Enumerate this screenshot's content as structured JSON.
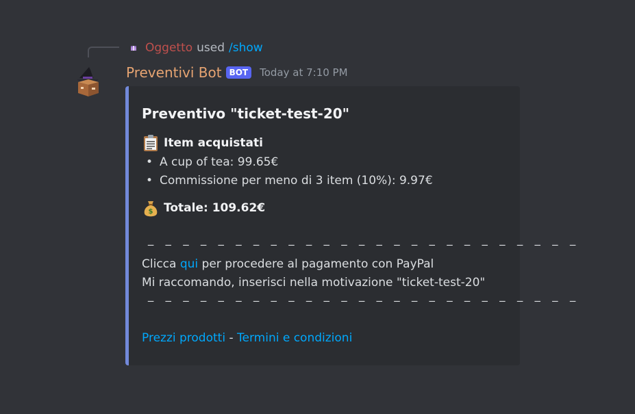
{
  "reply": {
    "user": "Oggetto",
    "used_text": "used",
    "command": "/show"
  },
  "message": {
    "username": "Preventivi Bot",
    "bot_tag": "BOT",
    "timestamp": "Today at 7:10 PM"
  },
  "embed": {
    "accent_color": "#7289da",
    "title": "Preventivo \"ticket-test-20\"",
    "items_heading": "Item acquistati",
    "items_icon": "clipboard-icon",
    "items": [
      "A cup of tea: 99.65€",
      "Commissione per meno di 3 item (10%): 9.97€"
    ],
    "total_icon": "money-bag-icon",
    "total": "Totale: 109.62€",
    "separator": "‒ ‒ ‒ ‒ ‒ ‒ ‒ ‒ ‒ ‒ ‒ ‒ ‒ ‒ ‒ ‒ ‒ ‒ ‒ ‒ ‒ ‒ ‒ ‒ ‒",
    "pay_prefix": "Clicca ",
    "pay_link": "qui",
    "pay_suffix": " per procedere al pagamento con PayPal",
    "note": "Mi raccomando, inserisci nella motivazione \"ticket-test-20\"",
    "footer_link1": "Prezzi prodotti",
    "footer_sep": " - ",
    "footer_link2": "Termini e condizioni"
  }
}
